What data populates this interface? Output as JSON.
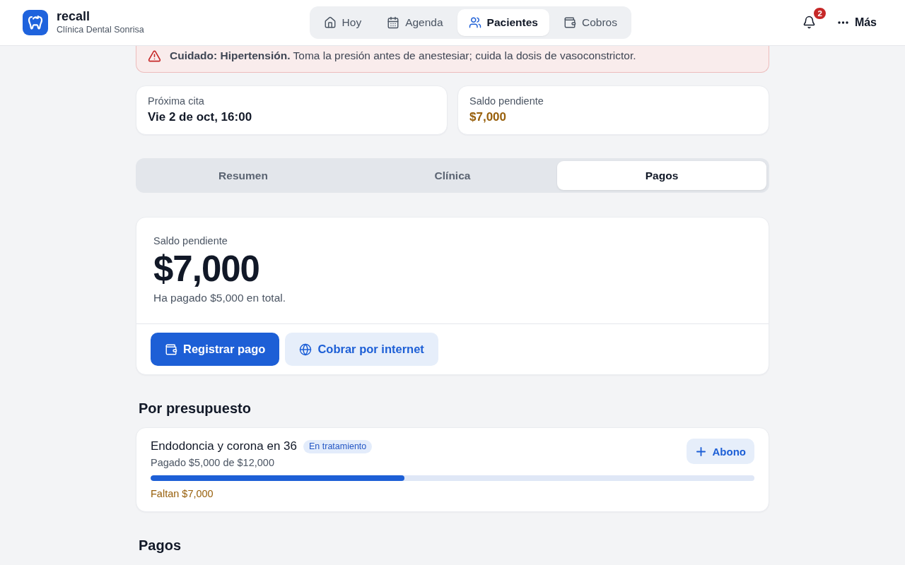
{
  "app": {
    "name": "recall",
    "clinic": "Clínica Dental Sonrisa"
  },
  "nav": [
    {
      "label": "Hoy",
      "selected": false
    },
    {
      "label": "Agenda",
      "selected": false
    },
    {
      "label": "Pacientes",
      "selected": true
    },
    {
      "label": "Cobros",
      "selected": false
    }
  ],
  "notifications": {
    "count": "2"
  },
  "more_menu": {
    "label": "Más"
  },
  "alert": {
    "text": "**Cuidado: Hipertensión.** Toma la presión antes de anestesiar; cuida la dosis de vasoconstrictor."
  },
  "summary_cards": [
    {
      "label": "Próxima cita",
      "value": "Vie 2 de oct, 16:00",
      "kind": "plain"
    },
    {
      "label": "Saldo pendiente",
      "value": "$7,000",
      "kind": "warning"
    }
  ],
  "section_tabs": [
    {
      "label": "Resumen",
      "selected": false
    },
    {
      "label": "Clínica",
      "selected": false
    },
    {
      "label": "Pagos",
      "selected": true
    }
  ],
  "balance": {
    "label": "Saldo pendiente",
    "amount": "$7,000",
    "note": "Ha pagado $5,000 en total.",
    "actions": [
      {
        "label": "Registrar pago",
        "kind": "primary"
      },
      {
        "label": "Cobrar por internet",
        "kind": "secondary"
      }
    ]
  },
  "budgets": {
    "title": "Por presupuesto",
    "items": [
      {
        "name": "Endodoncia y corona en 36",
        "status": "En tratamiento",
        "paid": "Pagado $5,000 de $12,000",
        "level": 0.42,
        "remaining": "Faltan $7,000",
        "action": "Abono"
      }
    ]
  },
  "payments": {
    "title": "Pagos"
  }
}
